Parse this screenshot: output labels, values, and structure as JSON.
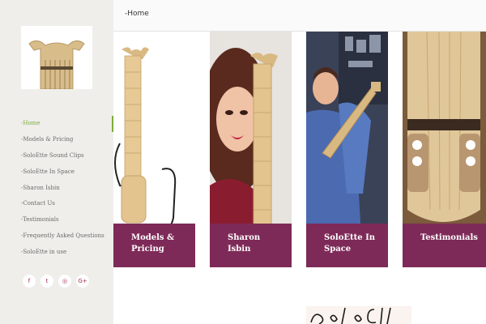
{
  "breadcrumb": "-Home",
  "nav": [
    {
      "label": "-Home",
      "active": true
    },
    {
      "label": "-Models & Pricing"
    },
    {
      "label": "-SoloEtte Sound Clips"
    },
    {
      "label": "-SoloEtte In Space"
    },
    {
      "label": "-Sharon Isbin"
    },
    {
      "label": "-Contact Us"
    },
    {
      "label": "-Testimonials"
    },
    {
      "label": "-Frequently Asked Questions"
    },
    {
      "label": "-SoloEtte in use"
    }
  ],
  "social": [
    {
      "icon": "facebook-icon",
      "glyph": "f"
    },
    {
      "icon": "twitter-icon",
      "glyph": "t"
    },
    {
      "icon": "instagram-icon",
      "glyph": "◎"
    },
    {
      "icon": "google-plus-icon",
      "glyph": "G+"
    }
  ],
  "tiles": [
    {
      "name": "models-pricing",
      "caption": "Models & Pricing"
    },
    {
      "name": "sharon-isbin",
      "caption": "Sharon Isbin"
    },
    {
      "name": "soloette-in-space",
      "caption": "SoloEtte In Space"
    },
    {
      "name": "testimonials",
      "caption": "Testimonials"
    }
  ],
  "colors": {
    "accent": "#7cad3b",
    "caption_bg": "#7e2a58",
    "sidebar_bg": "#efeeea"
  }
}
